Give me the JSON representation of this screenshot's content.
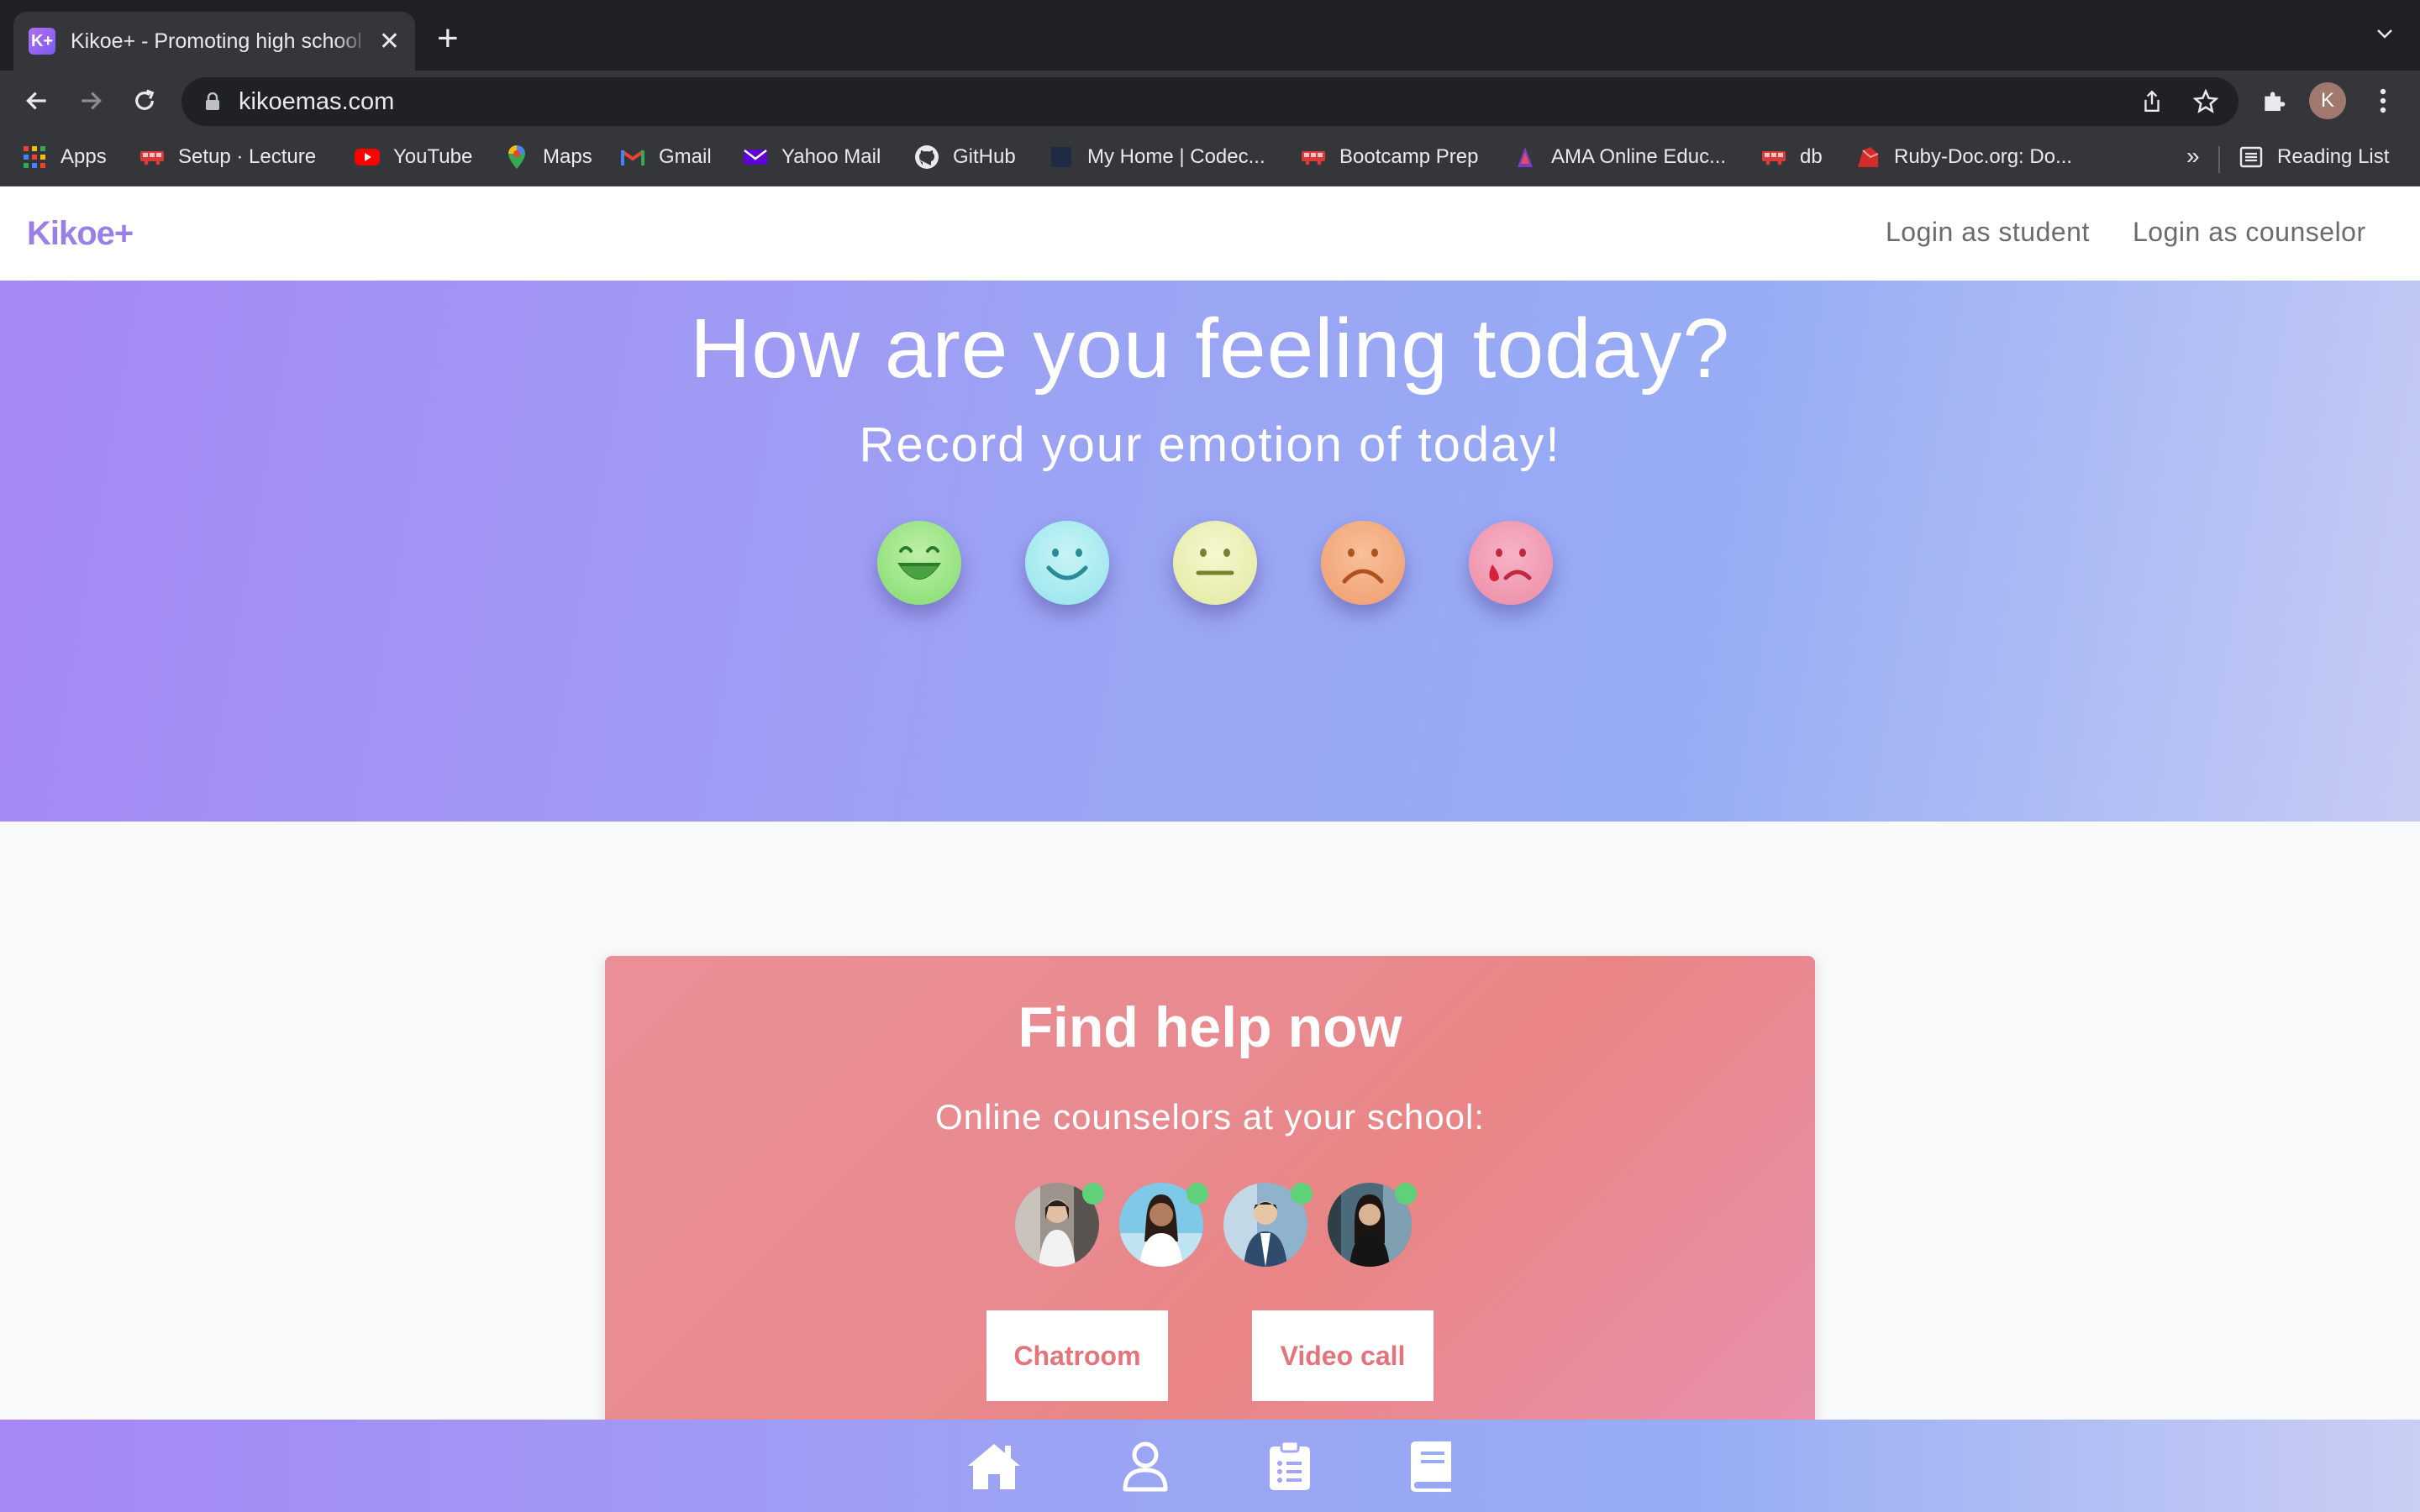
{
  "browser": {
    "tab_title": "Kikoe+ - Promoting high school",
    "tab_favicon": "K+",
    "url": "kikoemas.com",
    "profile_initial": "K",
    "bookmarks": [
      {
        "label": "Apps",
        "icon": "apps-grid-icon"
      },
      {
        "label": "Setup · Lecture",
        "icon": "bus-icon"
      },
      {
        "label": "YouTube",
        "icon": "youtube-icon"
      },
      {
        "label": "Maps",
        "icon": "maps-pin-icon"
      },
      {
        "label": "Gmail",
        "icon": "gmail-icon"
      },
      {
        "label": "Yahoo Mail",
        "icon": "yahoo-mail-icon"
      },
      {
        "label": "GitHub",
        "icon": "github-icon"
      },
      {
        "label": "My Home | Codec...",
        "icon": "codecademy-icon"
      },
      {
        "label": "Bootcamp Prep",
        "icon": "bus-icon"
      },
      {
        "label": "AMA Online Educ...",
        "icon": "ama-icon"
      },
      {
        "label": "db",
        "icon": "bus-icon"
      },
      {
        "label": "Ruby-Doc.org: Do...",
        "icon": "ruby-icon"
      }
    ],
    "bookmarks_more": "»",
    "reading_list": "Reading List"
  },
  "navbar": {
    "logo": "Kikoe+",
    "login_student": "Login as student",
    "login_counselor": "Login as counselor"
  },
  "hero": {
    "title": "How are you feeling today?",
    "subtitle": "Record your emotion of today!",
    "emotions": [
      "very-happy-emoji",
      "happy-emoji",
      "neutral-emoji",
      "sad-emoji",
      "crying-emoji"
    ]
  },
  "help_card": {
    "title": "Find help now",
    "subtitle": "Online counselors at your school:",
    "chatroom_label": "Chatroom",
    "video_call_label": "Video call"
  },
  "bottom_nav": [
    "home-icon",
    "profile-icon",
    "clipboard-list-icon",
    "book-icon"
  ],
  "colors": {
    "brand_purple": "#9b7fe8",
    "card_pink": "#e98a8f",
    "online_green": "#5fd178",
    "button_text": "#e5747a"
  }
}
